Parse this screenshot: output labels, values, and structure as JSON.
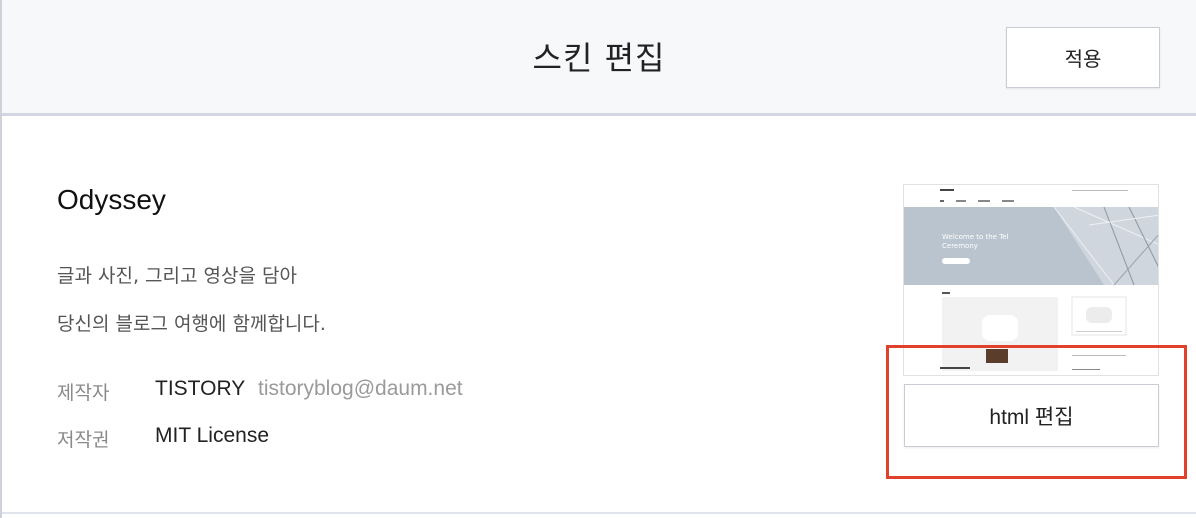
{
  "header": {
    "title": "스킨 편집",
    "apply_label": "적용"
  },
  "skin": {
    "name": "Odyssey",
    "description_lines": [
      "글과 사진, 그리고 영상을 담아",
      "당신의 블로그 여행에 함께합니다."
    ],
    "author_label": "제작자",
    "author_name": "TISTORY",
    "author_email": "tistoryblog@daum.net",
    "license_label": "저작권",
    "license_value": "MIT License"
  },
  "preview": {
    "hero_text_line1": "Welcome to the Tel",
    "hero_text_line2": "Ceremony"
  },
  "actions": {
    "html_edit_label": "html 편집"
  },
  "colors": {
    "highlight": "#e0412b",
    "header_bg": "#f7f8fa"
  }
}
